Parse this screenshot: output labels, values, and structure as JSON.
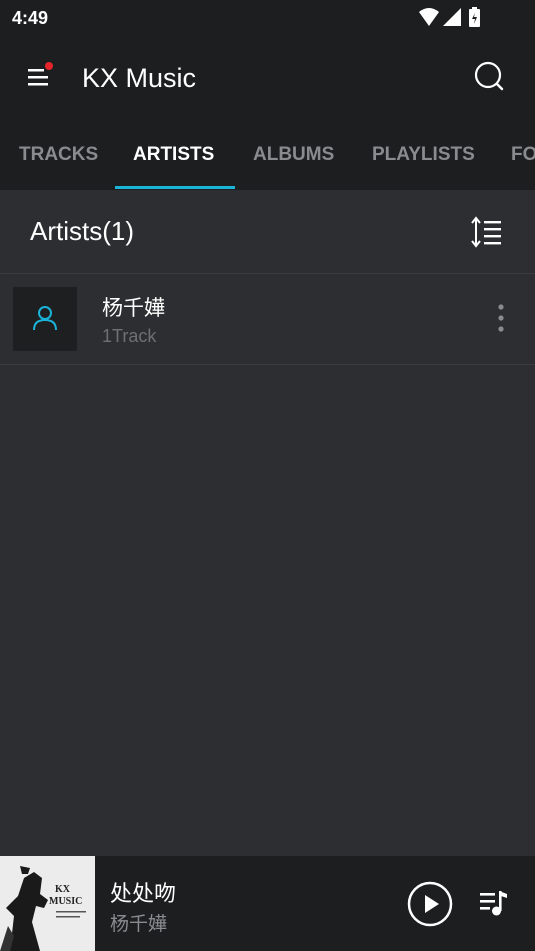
{
  "status_bar": {
    "time": "4:49"
  },
  "app_bar": {
    "title": "KX Music"
  },
  "tabs": [
    {
      "label": "TRACKS",
      "active": false
    },
    {
      "label": "ARTISTS",
      "active": true
    },
    {
      "label": "ALBUMS",
      "active": false
    },
    {
      "label": "PLAYLISTS",
      "active": false
    },
    {
      "label": "FO",
      "active": false
    }
  ],
  "section": {
    "title": "Artists(1)"
  },
  "artists": [
    {
      "name": "杨千嬅",
      "count": "1Track"
    }
  ],
  "now_playing": {
    "title": "处处吻",
    "artist": "杨千嬅",
    "cover_text": [
      "KX",
      "MUSIC"
    ]
  },
  "colors": {
    "accent": "#1ab4d8",
    "notification_dot": "#e5252a",
    "background": "#2d2e31",
    "bar_background": "#1d1e20"
  },
  "icons": [
    "menu-icon",
    "search-icon",
    "sort-icon",
    "person-icon",
    "more-vert-icon",
    "play-icon",
    "queue-music-icon",
    "wifi-icon",
    "signal-icon",
    "battery-icon"
  ]
}
